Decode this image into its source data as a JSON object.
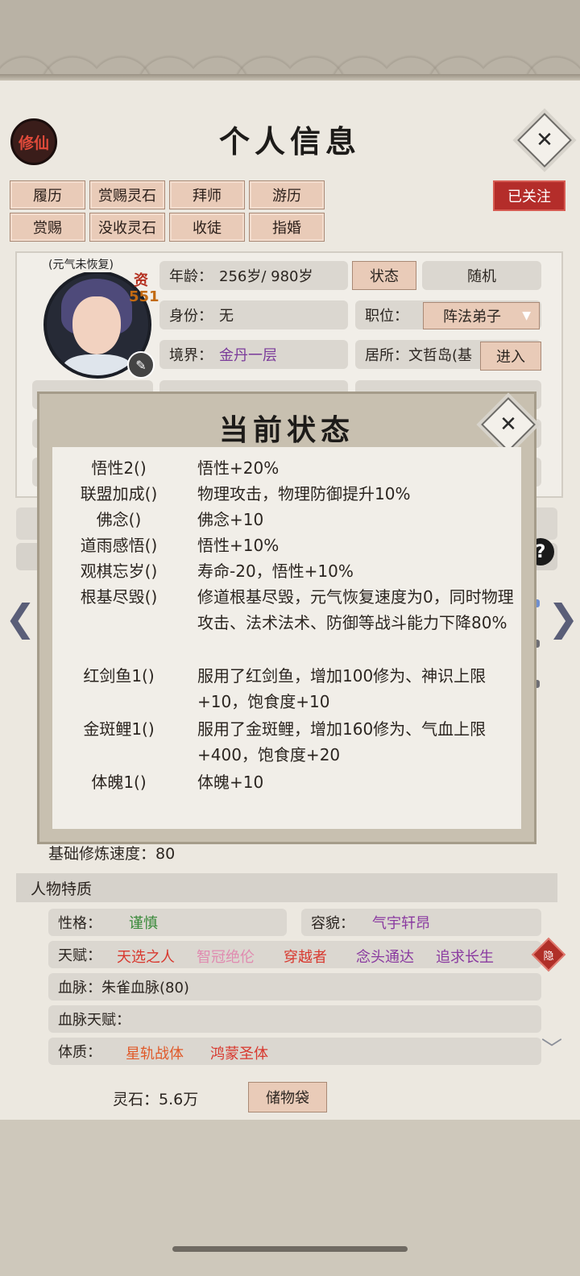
{
  "header": {
    "app_badge": "修仙",
    "title": "个人信息",
    "close": "✕"
  },
  "actions": {
    "row1": [
      "履历",
      "赏赐灵石",
      "拜师",
      "游历"
    ],
    "row2": [
      "赏赐",
      "没收灵石",
      "收徒",
      "指婚"
    ],
    "follow": "已关注"
  },
  "profile": {
    "avatar_note": "(元气未恢复)",
    "zi_label": "资",
    "zi_value": "551",
    "age_label": "年龄：",
    "age_value": "256岁/ 980岁",
    "status_btn": "状态",
    "random_btn": "随机",
    "identity_label": "身份：",
    "identity_value": "无",
    "post_label": "职位：",
    "post_value": "阵法弟子",
    "realm_label": "境界：",
    "realm_value": "金丹一层",
    "residence_label": "居所：",
    "residence_value": "文哲岛(基",
    "enter_btn": "进入"
  },
  "modal": {
    "title": "当前状态",
    "close": "✕",
    "rows": [
      {
        "name": "悟性2()",
        "effect": "悟性+20%"
      },
      {
        "name": "联盟加成()",
        "effect": "物理攻击，物理防御提升10%"
      },
      {
        "name": "佛念()",
        "effect": "佛念+10"
      },
      {
        "name": "道雨感悟()",
        "effect": "悟性+10%"
      },
      {
        "name": "观棋忘岁()",
        "effect": "寿命-20，悟性+10%"
      },
      {
        "name": "根基尽毁()",
        "effect": "修道根基尽毁，元气恢复速度为0，同时物理攻击、法术法术、防御等战斗能力下降80%"
      },
      {
        "name": "红剑鱼1()",
        "effect": "服用了红剑鱼，增加100修为、神识上限+10，饱食度+10"
      },
      {
        "name": "金斑鲤1()",
        "effect": "服用了金斑鲤，增加160修为、气血上限+400，饱食度+20"
      },
      {
        "name": "体魄1()",
        "effect": "体魄+10"
      }
    ]
  },
  "cultivation": {
    "speed_label": "基础修炼速度：",
    "speed_value": "80"
  },
  "traits": {
    "section_title": "人物特质",
    "personality_label": "性格：",
    "personality_value": "谨慎",
    "looks_label": "容貌：",
    "looks_value": "气宇轩昂",
    "talent_label": "天赋：",
    "talents": [
      {
        "text": "天选之人",
        "color": "#d8382e"
      },
      {
        "text": "智冠绝伦",
        "color": "#e08bb0"
      },
      {
        "text": "穿越者",
        "color": "#d8382e"
      },
      {
        "text": "念头通达",
        "color": "#8a3aa0"
      },
      {
        "text": "追求长生",
        "color": "#8a3aa0"
      }
    ],
    "hidden_badge": "隐",
    "bloodline_label": "血脉：",
    "bloodline_value": "朱雀血脉(80)",
    "bloodline_talent_label": "血脉天赋：",
    "physique_label": "体质：",
    "physiques": [
      {
        "text": "星轨战体",
        "color": "#e05a2a"
      },
      {
        "text": "鸿蒙圣体",
        "color": "#d8382e"
      }
    ]
  },
  "footer": {
    "spirit_stone_label": "灵石：",
    "spirit_stone_value": "5.6万",
    "bag_btn": "储物袋"
  },
  "colors": {
    "accent_red": "#b42d2a",
    "realm_purple": "#7a3a9a",
    "personality_green": "#3a8a3a"
  }
}
